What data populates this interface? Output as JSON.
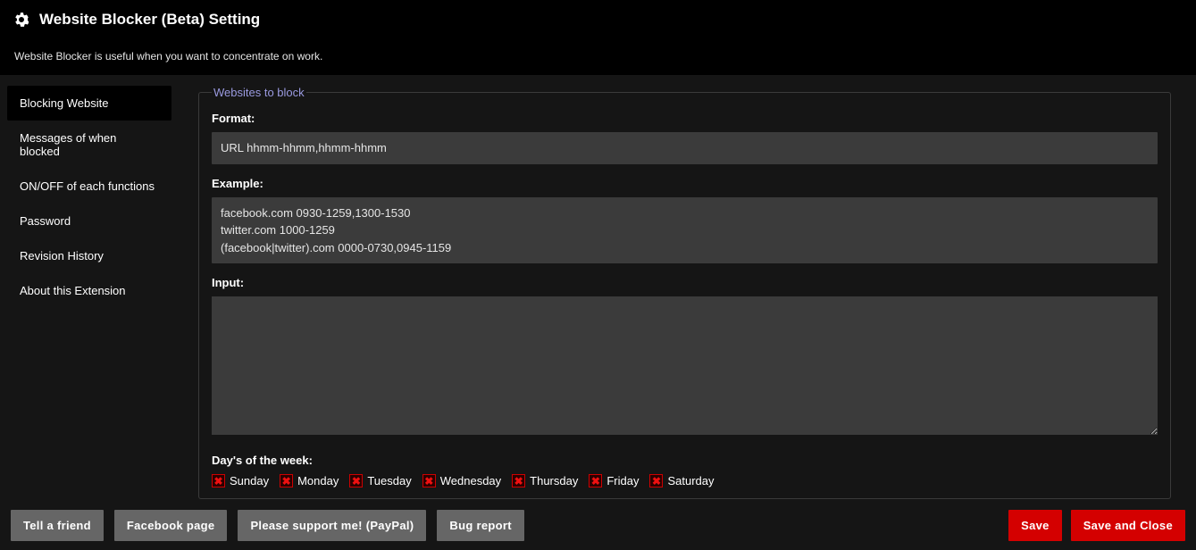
{
  "header": {
    "title": "Website Blocker (Beta) Setting",
    "icon": "gear-icon",
    "subtitle": "Website Blocker is useful when you want to concentrate on work."
  },
  "sidebar": {
    "items": [
      {
        "label": "Blocking Website",
        "active": true
      },
      {
        "label": "Messages of when blocked",
        "active": false
      },
      {
        "label": "ON/OFF of each functions",
        "active": false
      },
      {
        "label": "Password",
        "active": false
      },
      {
        "label": "Revision History",
        "active": false
      },
      {
        "label": "About this Extension",
        "active": false
      }
    ]
  },
  "panel": {
    "legend": "Websites to block",
    "format_label": "Format:",
    "format_value": "URL hhmm-hhmm,hhmm-hhmm",
    "example_label": "Example:",
    "example_lines": [
      "facebook.com 0930-1259,1300-1530",
      "twitter.com 1000-1259",
      "(facebook|twitter).com 0000-0730,0945-1159"
    ],
    "input_label": "Input:",
    "input_value": "",
    "days_label": "Day's of the week:",
    "days": [
      {
        "label": "Sunday",
        "checked": true
      },
      {
        "label": "Monday",
        "checked": true
      },
      {
        "label": "Tuesday",
        "checked": true
      },
      {
        "label": "Wednesday",
        "checked": true
      },
      {
        "label": "Thursday",
        "checked": true
      },
      {
        "label": "Friday",
        "checked": true
      },
      {
        "label": "Saturday",
        "checked": true
      }
    ]
  },
  "footer": {
    "left_buttons": [
      {
        "label": "Tell a friend"
      },
      {
        "label": "Facebook page"
      },
      {
        "label": "Please support me! (PayPal)"
      },
      {
        "label": "Bug report"
      }
    ],
    "right_buttons": [
      {
        "label": "Save"
      },
      {
        "label": "Save and Close"
      }
    ]
  },
  "colors": {
    "bg": "#151515",
    "panel_border": "#3a3a3a",
    "legend": "#9a9ae0",
    "button_grey": "#666666",
    "button_red": "#d40000",
    "checkbox_red": "#ef1010"
  }
}
